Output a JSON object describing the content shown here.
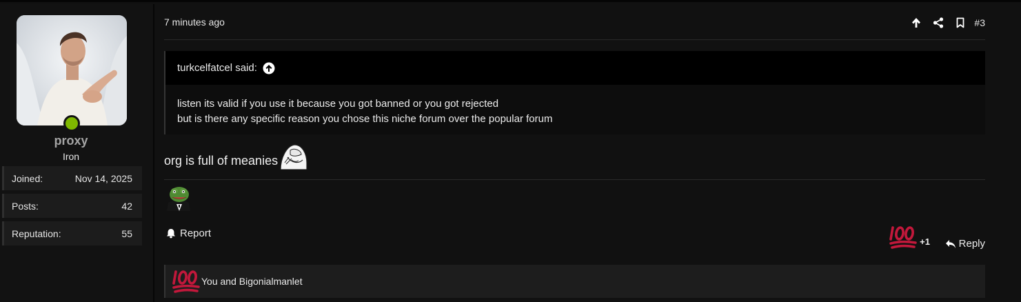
{
  "user": {
    "name": "proxy",
    "title": "Iron",
    "status_color": "#7fb800",
    "stats": [
      {
        "label": "Joined:",
        "value": "Nov 14, 2025"
      },
      {
        "label": "Posts:",
        "value": "42"
      },
      {
        "label": "Reputation:",
        "value": "55"
      }
    ]
  },
  "post": {
    "date": "7 minutes ago",
    "number": "#3",
    "header_icons": [
      "arrow-up-icon",
      "share-icon",
      "bookmark-icon"
    ],
    "quote": {
      "author": "turkcelfatcel said:",
      "lines": [
        "listen its valid if you use it because you got banned or you got rejected",
        "but is there any specific reason you chose this niche forum over the popular forum"
      ]
    },
    "message": "org is full of meanies",
    "actions": {
      "report": "Report",
      "reaction_count": "+1",
      "reply": "Reply"
    },
    "reactions_summary": "You and Bigonialmanlet",
    "colors": {
      "reaction_red": "#c2183b",
      "accent_green": "#7fb800"
    }
  }
}
